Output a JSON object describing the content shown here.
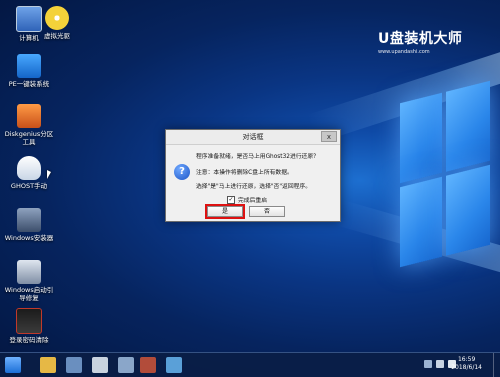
{
  "desktop": {
    "icons": [
      {
        "label": "计算机",
        "icon": "computer-icon",
        "color": "#3a78d8"
      },
      {
        "label": "虚拟光驱",
        "icon": "virtual-drive-icon",
        "color": "#f2c21a"
      },
      {
        "label": "PE一键装系统",
        "icon": "pe-install-icon",
        "color": "#1e90ff"
      },
      {
        "label": "Diskgenius分区工具",
        "icon": "diskgenius-icon",
        "color": "#e8711f"
      },
      {
        "label": "GHOST手动",
        "icon": "ghost-icon",
        "color": "#dfe6ef"
      },
      {
        "label": "Windows安装器",
        "icon": "windows-installer-icon",
        "color": "#5b6c88"
      },
      {
        "label": "Windows启动引导修复",
        "icon": "boot-repair-icon",
        "color": "#8c9bb0"
      },
      {
        "label": "登录密码清除",
        "icon": "password-clear-icon",
        "color": "#c0392b"
      }
    ]
  },
  "brand": {
    "logo": "U盘装机大师",
    "url": "www.upandashi.com"
  },
  "dialog": {
    "title": "对话框",
    "close_label": "x",
    "line1": "程序准备就绪，是否马上用Ghost32进行还原？",
    "line2": "注意：本操作将删除C盘上所有数据。",
    "line3": "选择\"是\"马上进行还原，选择\"否\"返回程序。",
    "checkbox_label": "完成后重启",
    "checkbox_checked": true,
    "checkbox_mark": "✓",
    "yes_label": "是",
    "no_label": "否",
    "question_glyph": "?"
  },
  "taskbar": {
    "apps": [
      {
        "icon": "start-icon",
        "color": "#3f8fe8"
      },
      {
        "icon": "file-manager-icon",
        "color": "#e6b845"
      },
      {
        "icon": "computer-app-icon",
        "color": "#6a8fbf"
      },
      {
        "icon": "tool-app-icon",
        "color": "#c9d3df"
      },
      {
        "icon": "partition-app-icon",
        "color": "#8aa6c9"
      },
      {
        "icon": "network-app-icon",
        "color": "#b24c3a"
      },
      {
        "icon": "app-icon",
        "color": "#5aa0d8"
      }
    ],
    "time": "16:59",
    "date": "2018/6/14"
  },
  "colors": {
    "dialog_bg": "#f0f0f0",
    "highlight": "#d11111",
    "wallpaper": "#0a3583"
  }
}
